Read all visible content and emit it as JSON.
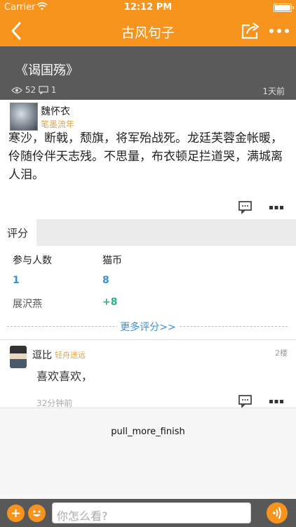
{
  "status_bar": {
    "carrier": "Carrier",
    "time": "12:12 PM"
  },
  "nav": {
    "title": "古风句子",
    "back_icon": "chevron-left-icon",
    "share_icon": "share-icon",
    "more_icon": "more-dots-icon"
  },
  "post": {
    "title": "《谒国殇》",
    "views": "52",
    "comments": "1",
    "time_ago": "1天前"
  },
  "author": {
    "name": "魏怀衣",
    "subtitle": "笔墨流年",
    "content": "寒沙，断戟，颓旗，将军殆战死。龙廷芙蓉金帐暖，伶随伶伴天志残。不思量，布衣顿足拦道哭，满城离人泪。"
  },
  "rating": {
    "tab_label": "评分",
    "headers": [
      "参与人数",
      "猫币"
    ],
    "summary": [
      "1",
      "8"
    ],
    "rows": [
      {
        "user": "展沢燕",
        "value": "+8"
      }
    ],
    "more_label": "更多评分>>"
  },
  "comment": {
    "name": "逗比",
    "tag": "轻舟送远",
    "floor": "2楼",
    "text": "喜欢喜欢，",
    "time": "32分钟前"
  },
  "pull_status": "pull_more_finish",
  "bottom_bar": {
    "placeholder": "你怎么看?",
    "add_label": "+",
    "emoji_icon": "smiley-icon",
    "voice_icon": "voice-icon"
  },
  "colors": {
    "accent": "#f7941d",
    "hero_bg": "#5a5a5a",
    "link": "#3a8fd8",
    "positive": "#2ab37d",
    "tag": "#e8a33a"
  }
}
